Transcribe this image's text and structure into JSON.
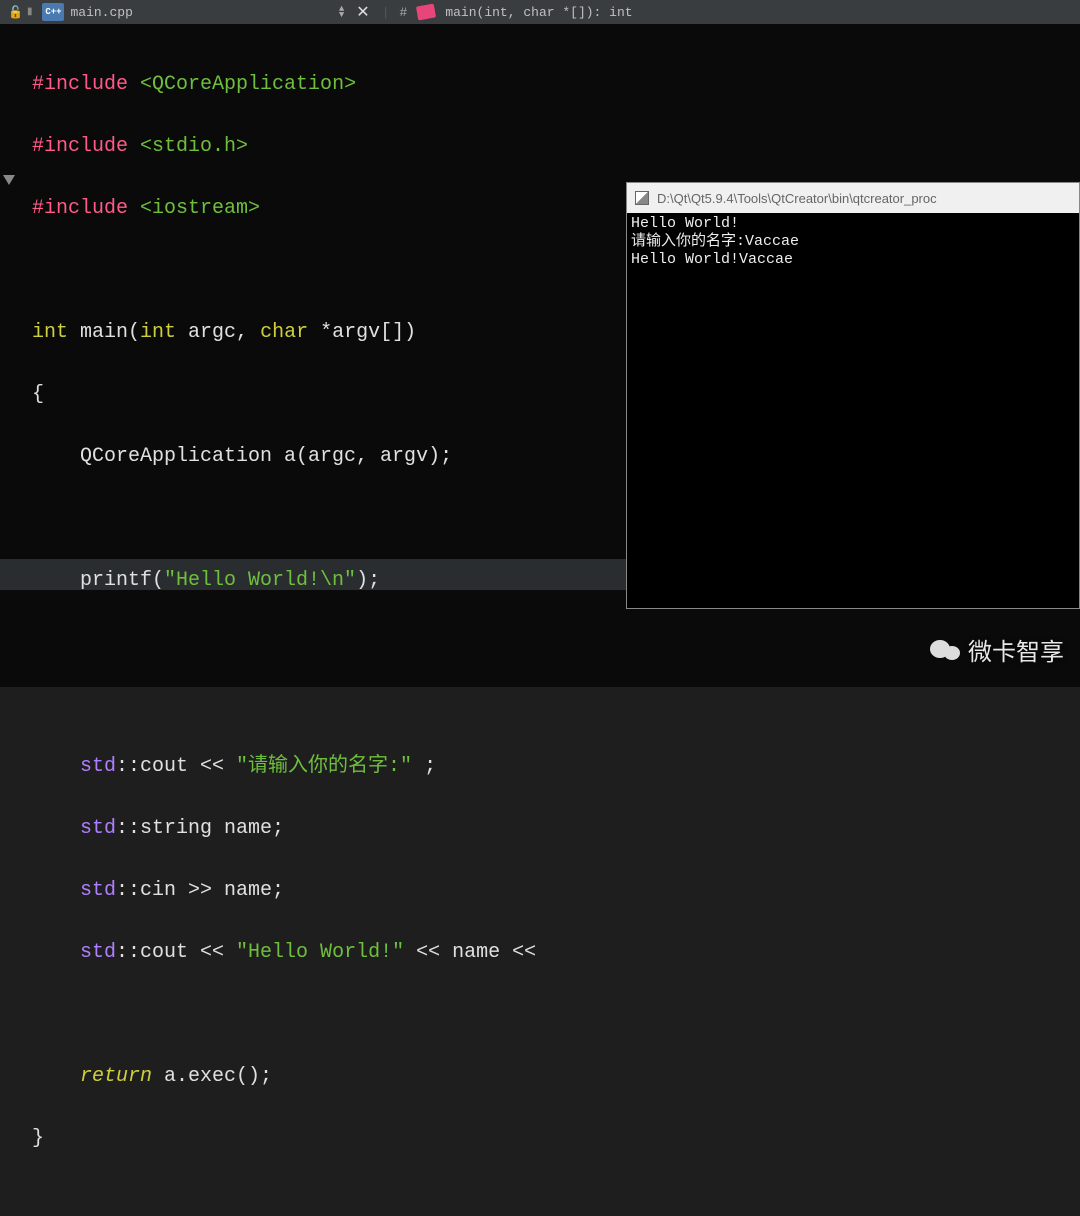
{
  "toolbar": {
    "cpp_badge": "C++",
    "filename": "main.cpp",
    "hash": "#",
    "symbol": "main(int, char *[]): int"
  },
  "code": {
    "l1_pre": "#include",
    "l1_inc": "<QCoreApplication>",
    "l2_pre": "#include",
    "l2_inc": "<stdio.h>",
    "l3_pre": "#include",
    "l3_inc": "<iostream>",
    "l5_a": "int",
    "l5_b": " main(",
    "l5_c": "int",
    "l5_d": " argc, ",
    "l5_e": "char",
    "l5_f": " *argv[])",
    "l6": "{",
    "l7_a": "    QCoreApplication a(argc, argv);",
    "l9_a": "    printf(",
    "l9_b": "\"Hello World!\\n\"",
    "l9_c": ");",
    "l12_a": "    std",
    "l12_b": "::cout << ",
    "l12_c": "\"请输入你的名字:\"",
    "l12_d": " ;",
    "l13_a": "    std",
    "l13_b": "::string name;",
    "l14_a": "    std",
    "l14_b": "::cin >> name;",
    "l15_a": "    std",
    "l15_b": "::cout << ",
    "l15_c": "\"Hello World!\"",
    "l15_d": " << name <<",
    "l17_a": "    return",
    "l17_b": " a.exec();",
    "l18": "}"
  },
  "console": {
    "titlepath": "D:\\Qt\\Qt5.9.4\\Tools\\QtCreator\\bin\\qtcreator_proc",
    "line1": "Hello World!",
    "line2": "请输入你的名字:Vaccae",
    "line3": "Hello World!Vaccae"
  },
  "watermark": {
    "text": "微卡智享"
  }
}
